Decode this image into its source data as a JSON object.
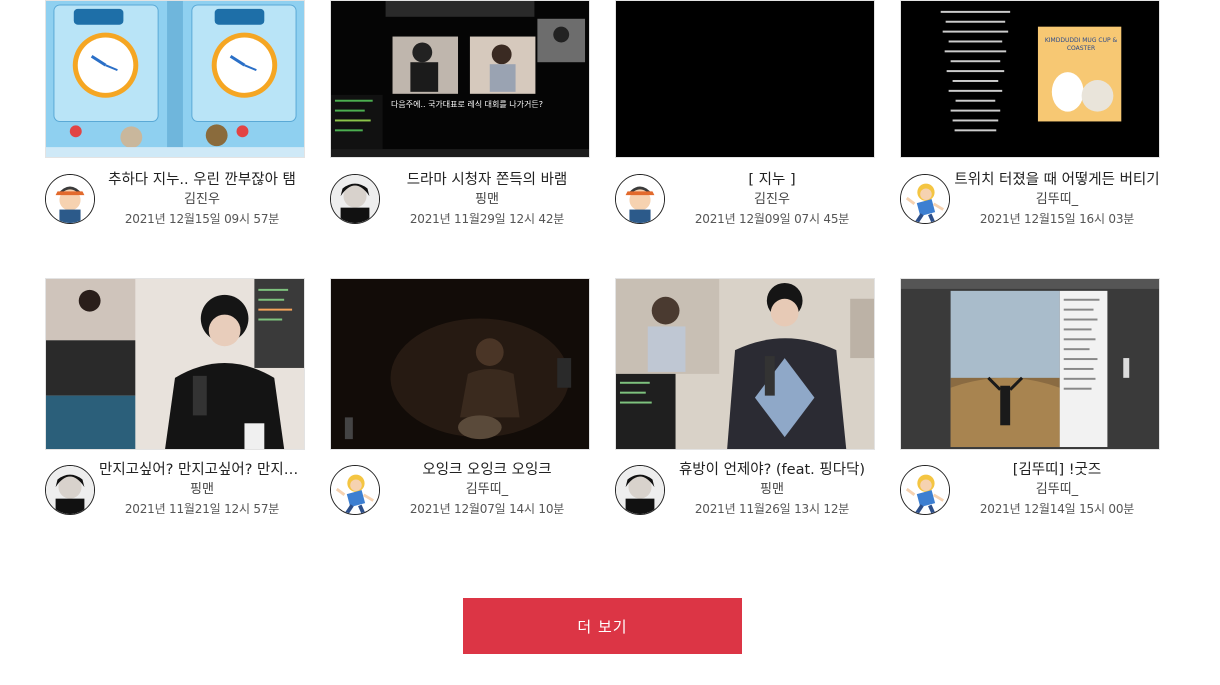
{
  "videos": [
    {
      "title": "추하다 지누.. 우린 깐부잖아 탬",
      "author": "김진우",
      "date": "2021년 12월15일 09시 57분",
      "thumb": "clock-game",
      "avatar": "boy-cap"
    },
    {
      "title": "드라마 시청자 쫀득의 바램",
      "author": "핑맨",
      "date": "2021년 11월29일 12시 42분",
      "thumb": "stream-collage",
      "thumb_caption": "다음주에.. 국가대표로 레식 대회를 나가거든?",
      "avatar": "dark-hair"
    },
    {
      "title": "[ 지누 ]",
      "author": "김진우",
      "date": "2021년 12월09일 07시 45분",
      "thumb": "black",
      "avatar": "boy-cap"
    },
    {
      "title": "트위치 터졌을 때 어떻게든 버티기",
      "author": "김뚜띠_",
      "date": "2021년 12월15일 16시 03분",
      "thumb": "mug-merch",
      "thumb_caption": "KIMDDUDDI MUG CUP & COASTER",
      "avatar": "blonde-pose"
    },
    {
      "title": "만지고싶어? 만지고싶어? 만지고싶어?",
      "author": "핑맨",
      "date": "2021년 11월21일 12시 57분",
      "thumb": "streamer-mic",
      "avatar": "dark-hair"
    },
    {
      "title": "오잉크 오잉크 오잉크",
      "author": "김뚜띠_",
      "date": "2021년 12월07일 14시 10분",
      "thumb": "dark-room",
      "avatar": "blonde-pose"
    },
    {
      "title": "휴방이 언제야? (feat. 핑다닥)",
      "author": "핑맨",
      "date": "2021년 11월26일 13시 12분",
      "thumb": "streamer-collab",
      "avatar": "dark-hair"
    },
    {
      "title": "[김뚜띠] !굿즈",
      "author": "김뚜띠_",
      "date": "2021년 12월14일 15시 00분",
      "thumb": "field-photo",
      "avatar": "blonde-pose"
    }
  ],
  "more_button": "더 보기",
  "colors": {
    "accent": "#dc3545"
  }
}
